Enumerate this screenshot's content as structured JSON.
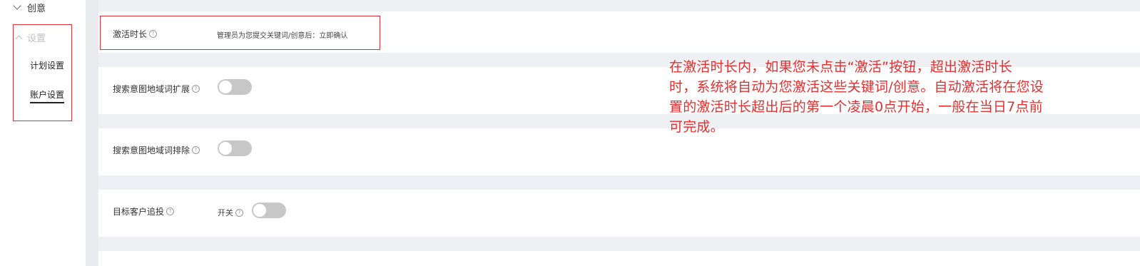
{
  "sidebar": {
    "creative_label": "创意",
    "settings_label": "设置",
    "items": [
      {
        "label": "计划设置"
      },
      {
        "label": "账户设置"
      }
    ]
  },
  "activation": {
    "label": "激活时长",
    "value": "管理员为您提交关键词/创意后：立即确认"
  },
  "annotation": {
    "lines": [
      "在激活时长内，如果您未点击“激活”按钮，超出激活时长",
      "时，系统将自动为您激活这些关键词/创意。自动激活将在您设",
      "置的激活时长超出后的第一个凌晨0点开始，一般在当日7点前",
      "可完成。"
    ],
    "color": "#e03131"
  },
  "rows": [
    {
      "label": "搜索意图地域词扩展",
      "toggle_on": false
    },
    {
      "label": "搜索意图地域词排除",
      "toggle_on": false
    },
    {
      "label": "目标客户追投",
      "switch_label": "开关",
      "toggle_on": false
    }
  ],
  "icons": {
    "help": "question-circle-icon",
    "collapse": "chevron-down-icon",
    "expand": "chevron-up-icon"
  },
  "help_glyph": "?"
}
